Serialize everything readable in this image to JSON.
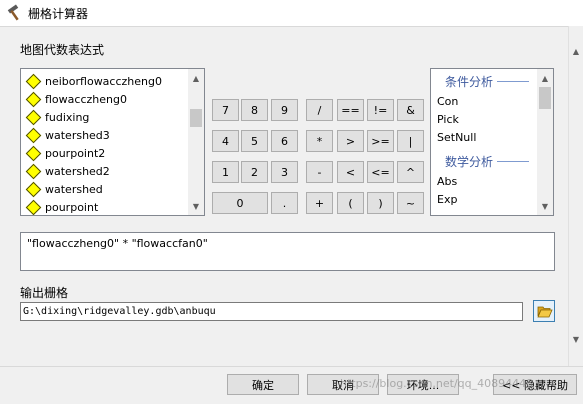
{
  "window": {
    "title": "栅格计算器",
    "icon": "hammer-icon"
  },
  "expression_section": {
    "label": "地图代数表达式"
  },
  "layers": [
    "neiborflowacczheng0",
    "flowacczheng0",
    "fudixing",
    "watershed3",
    "pourpoint2",
    "watershed2",
    "watershed",
    "pourpoint"
  ],
  "calculator": {
    "number_rows": [
      [
        "7",
        "8",
        "9"
      ],
      [
        "4",
        "5",
        "6"
      ],
      [
        "1",
        "2",
        "3"
      ]
    ],
    "zero": "0",
    "dot": ".",
    "op_rows": [
      [
        "/",
        "==",
        "!=",
        "&"
      ],
      [
        "*",
        ">",
        ">=",
        "|"
      ],
      [
        "-",
        "<",
        "<=",
        "^"
      ],
      [
        "+",
        "(",
        ")",
        "~"
      ]
    ]
  },
  "functions": {
    "groups": [
      {
        "title": "条件分析",
        "items": [
          "Con",
          "Pick",
          "SetNull"
        ]
      },
      {
        "title": "数学分析",
        "items": [
          "Abs",
          "Exp"
        ]
      }
    ]
  },
  "expression": {
    "text": "\"flowacczheng0\" * \"flowaccfan0\""
  },
  "output": {
    "label": "输出栅格",
    "value": "G:\\dixing\\ridgevalley.gdb\\anbuqu",
    "browse_icon": "folder-open-icon"
  },
  "footer": {
    "ok": "确定",
    "cancel": "取消",
    "environments": "环境...",
    "hide_help": "<< 隐藏帮助"
  },
  "watermark": "https://blog.csdn.net/qq_40894448"
}
